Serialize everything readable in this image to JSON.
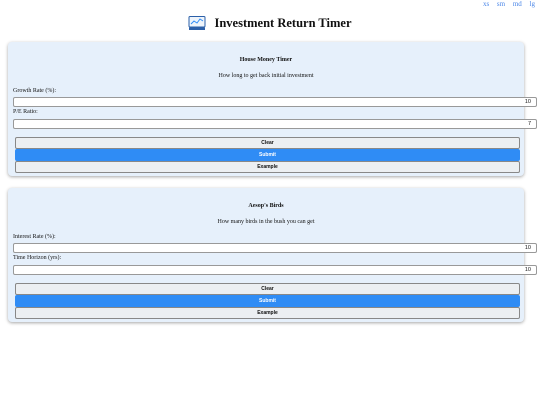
{
  "size_links": [
    "xs",
    "sm",
    "md",
    "lg"
  ],
  "header": {
    "title": "Investment Return Timer",
    "logo_icon": "chart-monitor-icon"
  },
  "cards": [
    {
      "title": "House Money Timer",
      "subtitle": "How long to get back initial investment",
      "fields": [
        {
          "label": "Growth Rate (%):",
          "value": "10"
        },
        {
          "label": "P/E Ratio:",
          "value": "7"
        }
      ],
      "buttons": {
        "clear": "Clear",
        "submit": "Submit",
        "example": "Example"
      }
    },
    {
      "title": "Aesop's Birds",
      "subtitle": "How many birds in the bush you can get",
      "fields": [
        {
          "label": "Interest Rate (%):",
          "value": "10"
        },
        {
          "label": "Time Horizon (yrs):",
          "value": "10"
        }
      ],
      "buttons": {
        "clear": "Clear",
        "submit": "Submit",
        "example": "Example"
      }
    }
  ],
  "colors": {
    "card_bg": "#e6f0fb",
    "primary": "#2f8cf5",
    "link": "#4a86e8"
  }
}
